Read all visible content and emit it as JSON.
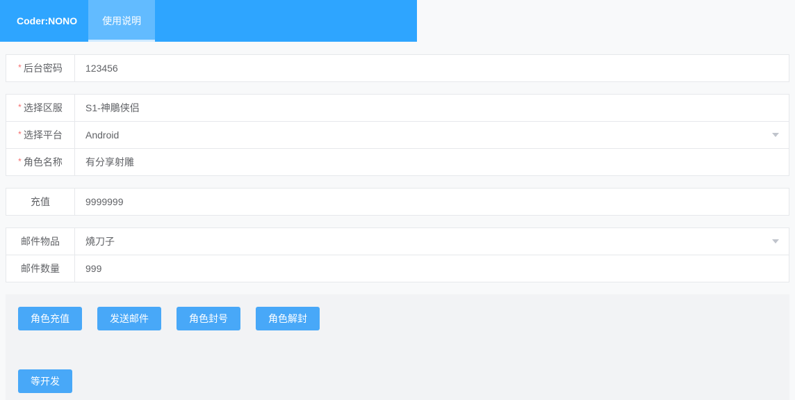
{
  "header": {
    "brand": "Coder:NONO",
    "tabs": [
      {
        "label": "使用说明",
        "selected": true
      }
    ]
  },
  "form": {
    "password": {
      "label": "后台密码",
      "value": "123456",
      "required": true
    },
    "server": {
      "label": "选择区服",
      "value": "S1-神鵰侠侣",
      "required": true
    },
    "platform": {
      "label": "选择平台",
      "value": "Android",
      "required": true
    },
    "role": {
      "label": "角色名称",
      "value": "有分享射雕",
      "required": true
    },
    "recharge": {
      "label": "充值",
      "value": "9999999",
      "required": false
    },
    "mail_item": {
      "label": "邮件物品",
      "value": "燒刀子",
      "required": false
    },
    "mail_qty": {
      "label": "邮件数量",
      "value": "999",
      "required": false
    }
  },
  "buttons": {
    "recharge": "角色充值",
    "sendmail": "发送邮件",
    "ban": "角色封号",
    "unban": "角色解封",
    "pending": "等开发"
  }
}
